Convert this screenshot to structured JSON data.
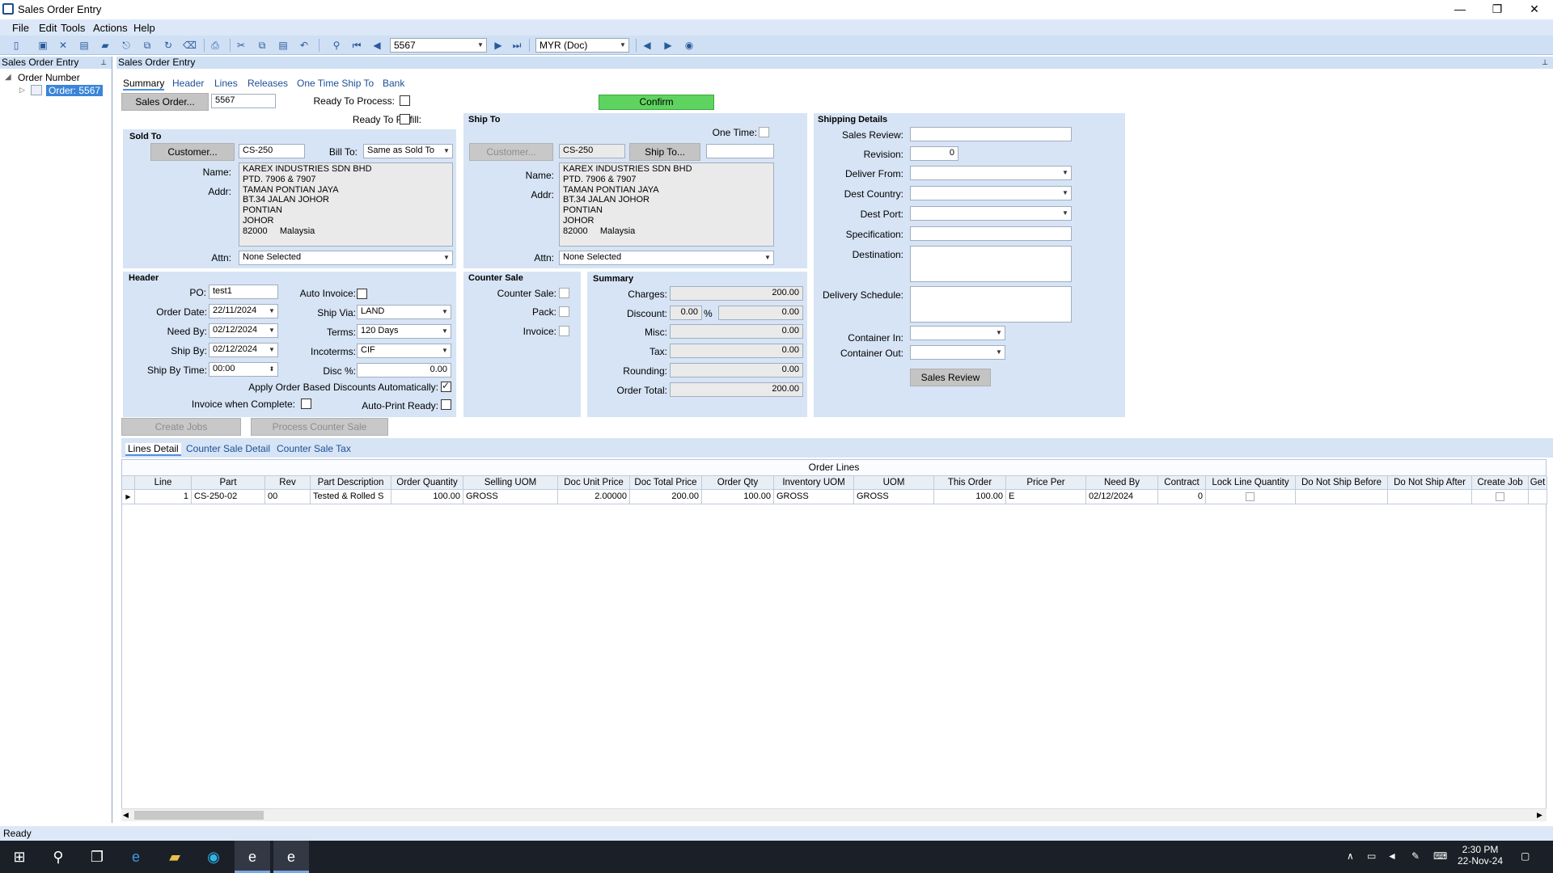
{
  "window": {
    "title": "Sales Order Entry"
  },
  "menu": [
    "File",
    "Edit",
    "Tools",
    "Actions",
    "Help"
  ],
  "toolbar": {
    "order_value": "5567",
    "currency": "MYR (Doc)"
  },
  "left_panel": {
    "title": "Sales Order Entry",
    "tree_root": "Order Number",
    "tree_item": "Order: 5567"
  },
  "main_panel": {
    "title": "Sales Order Entry"
  },
  "tabs": [
    "Summary",
    "Header",
    "Lines",
    "Releases",
    "One Time Ship To",
    "Bank"
  ],
  "top": {
    "sales_order_btn": "Sales Order...",
    "order_num": "5567",
    "ready_to_process": "Ready To Process:",
    "ready_to_fulfill": "Ready To Fulfill:",
    "confirm": "Confirm"
  },
  "sold_to": {
    "title": "Sold To",
    "customer_btn": "Customer...",
    "customer": "CS-250",
    "bill_to_label": "Bill To:",
    "bill_to": "Same as Sold To",
    "name_label": "Name:",
    "addr_label": "Addr:",
    "address": [
      "KAREX INDUSTRIES SDN BHD",
      "PTD. 7906 & 7907",
      "TAMAN PONTIAN JAYA",
      "BT.34 JALAN JOHOR",
      "PONTIAN",
      "JOHOR",
      "82000     Malaysia"
    ],
    "attn_label": "Attn:",
    "attn": "None Selected"
  },
  "ship_to": {
    "title": "Ship To",
    "one_time": "One Time:",
    "customer_btn": "Customer...",
    "customer": "CS-250",
    "ship_to_btn": "Ship To...",
    "name_label": "Name:",
    "addr_label": "Addr:",
    "address": [
      "KAREX INDUSTRIES SDN BHD",
      "PTD. 7906 & 7907",
      "TAMAN PONTIAN JAYA",
      "BT.34 JALAN JOHOR",
      "PONTIAN",
      "JOHOR",
      "82000     Malaysia"
    ],
    "attn_label": "Attn:",
    "attn": "None Selected"
  },
  "header": {
    "title": "Header",
    "po_label": "PO:",
    "po": "test1",
    "auto_invoice": "Auto Invoice:",
    "order_date_label": "Order Date:",
    "order_date": "22/11/2024",
    "ship_via_label": "Ship Via:",
    "ship_via": "LAND",
    "need_by_label": "Need By:",
    "need_by": "02/12/2024",
    "terms_label": "Terms:",
    "terms": "120 Days",
    "ship_by_label": "Ship By:",
    "ship_by": "02/12/2024",
    "incoterms_label": "Incoterms:",
    "incoterms": "CIF",
    "ship_by_time_label": "Ship By Time:",
    "ship_by_time": "00:00",
    "disc_label": "Disc %:",
    "disc": "0.00",
    "apply_discounts": "Apply Order Based Discounts Automatically:",
    "invoice_when_complete": "Invoice when Complete:",
    "auto_print": "Auto-Print Ready:"
  },
  "counter_sale": {
    "title": "Counter Sale",
    "counter_sale": "Counter Sale:",
    "pack": "Pack:",
    "invoice": "Invoice:"
  },
  "summary": {
    "title": "Summary",
    "charges_label": "Charges:",
    "charges": "200.00",
    "discount_label": "Discount:",
    "discount_pct": "0.00",
    "pct": "%",
    "discount": "0.00",
    "misc_label": "Misc:",
    "misc": "0.00",
    "tax_label": "Tax:",
    "tax": "0.00",
    "rounding_label": "Rounding:",
    "rounding": "0.00",
    "order_total_label": "Order Total:",
    "order_total": "200.00"
  },
  "shipping": {
    "title": "Shipping Details",
    "sales_review": "Sales Review:",
    "revision": "Revision:",
    "revision_val": "0",
    "deliver_from": "Deliver From:",
    "dest_country": "Dest Country:",
    "dest_port": "Dest Port:",
    "specification": "Specification:",
    "destination": "Destination:",
    "delivery_schedule": "Delivery Schedule:",
    "container_in": "Container In:",
    "container_out": "Container Out:",
    "sales_review_btn": "Sales Review"
  },
  "actions": {
    "create_jobs": "Create Jobs",
    "process_counter_sale": "Process Counter Sale"
  },
  "bottom_tabs": [
    "Lines Detail",
    "Counter Sale Detail",
    "Counter Sale Tax"
  ],
  "grid": {
    "caption": "Order Lines",
    "columns": [
      "Line",
      "Part",
      "Rev",
      "Part Description",
      "Order Quantity",
      "Selling UOM",
      "Doc Unit Price",
      "Doc Total Price",
      "Order Qty",
      "Inventory UOM",
      "UOM",
      "This Order",
      "Price Per",
      "Need By",
      "Contract",
      "Lock Line Quantity",
      "Do Not Ship Before",
      "Do Not Ship After",
      "Create Job",
      "Get"
    ],
    "row": [
      "1",
      "CS-250-02",
      "00",
      "Tested & Rolled S",
      "100.00",
      "GROSS",
      "2.00000",
      "200.00",
      "100.00",
      "GROSS",
      "GROSS",
      "100.00",
      "E",
      "02/12/2024",
      "0",
      "",
      "",
      "",
      "",
      ""
    ]
  },
  "status": "Ready",
  "clock": {
    "time": "2:30 PM",
    "date": "22-Nov-24"
  }
}
